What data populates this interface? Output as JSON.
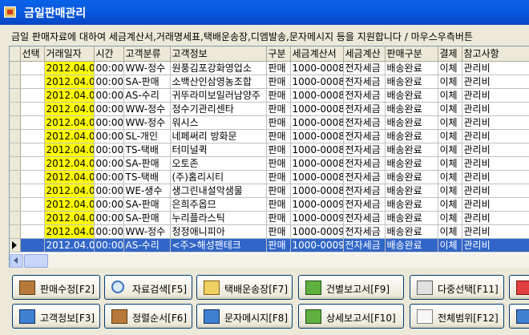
{
  "window": {
    "title": "금일판매관리"
  },
  "info": {
    "text": "금일 판매자료에 대하여 세금계산서,거래명세표,택배운송장,디엠발송,문자메시지 등을 지원합니다 / 마우스우측버튼"
  },
  "grid": {
    "columns": [
      "선택",
      "거래일자",
      "시간",
      "고객분류",
      "고객정보",
      "구분",
      "세금계산서",
      "세금계산",
      "판매구분",
      "결제",
      "참고사항"
    ],
    "rows": [
      [
        "",
        "2012.04.05",
        "00:00",
        "WW-정수",
        "원풍김포강화영업소",
        "판매",
        "1000-00080",
        "전자세금",
        "배송완료",
        "이체",
        "관리비"
      ],
      [
        "",
        "2012.04.05",
        "00:00",
        "SA-판매",
        "소백산인삼영농조합",
        "판매",
        "1000-00081",
        "전자세금",
        "배송완료",
        "이체",
        "관리비"
      ],
      [
        "",
        "2012.04.05",
        "00:00",
        "AS-수리",
        "귀뚜라미보일러남양주",
        "판매",
        "1000-00082",
        "전자세금",
        "배송완료",
        "이체",
        "관리비"
      ],
      [
        "",
        "2012.04.05",
        "00:00",
        "WW-정수",
        "정수기관리센타",
        "판매",
        "1000-00083",
        "전자세금",
        "배송완료",
        "이체",
        "관리비"
      ],
      [
        "",
        "2012.04.05",
        "00:00",
        "WW-정수",
        "워시스",
        "판매",
        "1000-00084",
        "전자세금",
        "배송완료",
        "이체",
        "관리비"
      ],
      [
        "",
        "2012.04.05",
        "00:00",
        "SL-개인",
        "네페써리 방화문",
        "판매",
        "1000-00085",
        "전자세금",
        "배송완료",
        "이체",
        "관리비"
      ],
      [
        "",
        "2012.04.05",
        "00:00",
        "TS-택배",
        "터미널퀵",
        "판매",
        "1000-00086",
        "전자세금",
        "배송완료",
        "이체",
        "관리비"
      ],
      [
        "",
        "2012.04.05",
        "00:00",
        "SA-판매",
        "오토존",
        "판매",
        "1000-00087",
        "전자세금",
        "배송완료",
        "이체",
        "관리비"
      ],
      [
        "",
        "2012.04.05",
        "00:00",
        "TS-택배",
        "(주)홈리시티",
        "판매",
        "1000-00088",
        "전자세금",
        "배송완료",
        "이체",
        "관리비"
      ],
      [
        "",
        "2012.04.05",
        "00:00",
        "WE-생수",
        "생그린내설악샘물",
        "판매",
        "1000-00089",
        "전자세금",
        "배송완료",
        "이체",
        "관리비"
      ],
      [
        "",
        "2012.04.05",
        "00:00",
        "SA-판매",
        "은희주옵므",
        "판매",
        "1000-00090",
        "전자세금",
        "배송완료",
        "이체",
        "관리비"
      ],
      [
        "",
        "2012.04.05",
        "00:00",
        "SA-판매",
        "누리플라스틱",
        "판매",
        "1000-00091",
        "전자세금",
        "배송완료",
        "이체",
        "관리비"
      ],
      [
        "",
        "2012.04.05",
        "00:00",
        "WW-정수",
        "청정애니피아",
        "판매",
        "1000-00092",
        "전자세금",
        "배송완료",
        "이체",
        "관리비"
      ],
      [
        "",
        "2012.04.05",
        "00:00",
        "AS-수리",
        "<주>해성팬테크",
        "판매",
        "1000-00093",
        "전자세금",
        "배송완료",
        "이체",
        "관리비"
      ]
    ],
    "selected_row_index": 13
  },
  "buttons": {
    "row1": [
      {
        "label": "판매수정[F2]",
        "icon": "edit-icon"
      },
      {
        "label": "자료검색[F5]",
        "icon": "magnifier-icon"
      },
      {
        "label": "택배운송장[F7]",
        "icon": "delivery-icon"
      },
      {
        "label": "건별보고서[F9]",
        "icon": "printer-icon"
      },
      {
        "label": "다중선택[F11]",
        "icon": "multi-select-icon"
      }
    ],
    "row2": [
      {
        "label": "고객정보[F3]",
        "icon": "customer-icon"
      },
      {
        "label": "정렬순서[F6]",
        "icon": "sort-icon"
      },
      {
        "label": "문자메시지[F8]",
        "icon": "message-icon"
      },
      {
        "label": "상세보고서[F10]",
        "icon": "report-printer-icon"
      },
      {
        "label": "전체범위[F12]",
        "icon": "document-icon"
      }
    ]
  }
}
